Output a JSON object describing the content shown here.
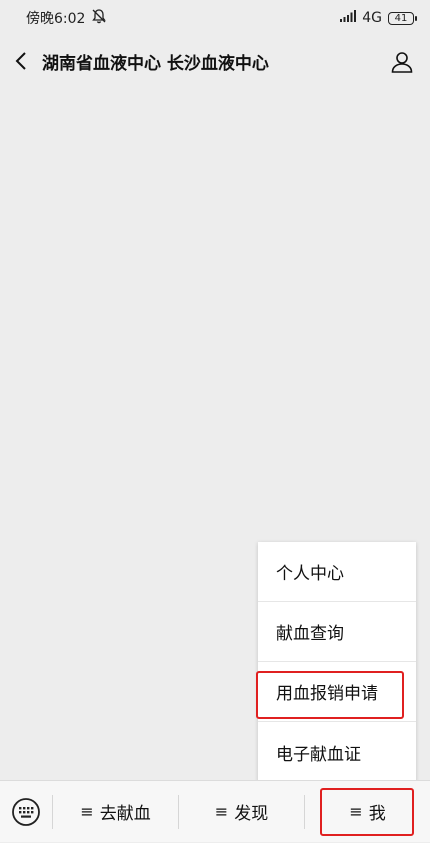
{
  "status_bar": {
    "time": "傍晚6:02",
    "network": "4G",
    "battery": "41"
  },
  "header": {
    "title": "湖南省血液中心 长沙血液中心"
  },
  "popup_menu": {
    "items": [
      {
        "label": "个人中心"
      },
      {
        "label": "献血查询"
      },
      {
        "label": "用血报销申请"
      },
      {
        "label": "电子献血证"
      }
    ]
  },
  "bottom_menu": {
    "tabs": [
      {
        "label": "去献血"
      },
      {
        "label": "发现"
      },
      {
        "label": "我"
      }
    ],
    "menu_glyph": "≡"
  },
  "colors": {
    "highlight": "#e02020",
    "background": "#ededed"
  }
}
